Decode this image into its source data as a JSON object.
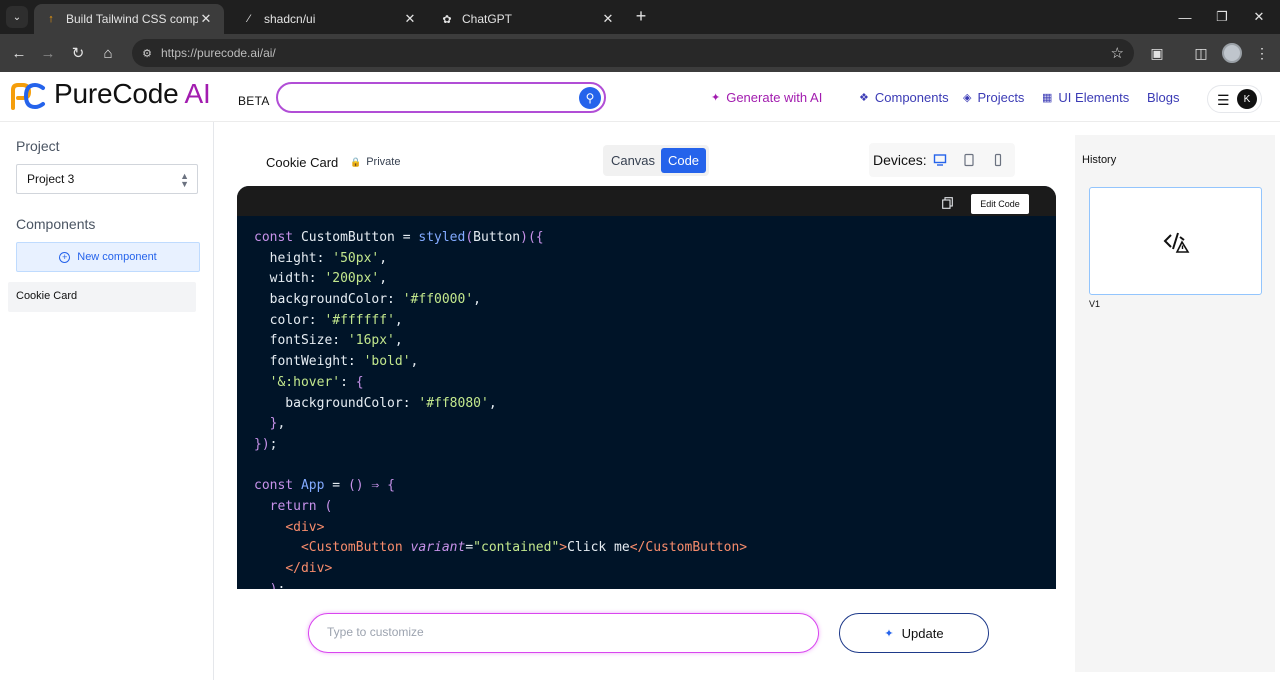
{
  "browser": {
    "tabs": [
      {
        "title": "Build Tailwind CSS components",
        "active": true,
        "icon": "purecode-favicon-icon"
      },
      {
        "title": "shadcn/ui",
        "active": false,
        "icon": "shadcn-favicon-icon"
      },
      {
        "title": "ChatGPT",
        "active": false,
        "icon": "chatgpt-favicon-icon"
      }
    ],
    "url": "https://purecode.ai/ai/"
  },
  "header": {
    "logo_main": "PureCode",
    "logo_ai": "AI",
    "beta": "BETA",
    "search_placeholder": "",
    "nav": {
      "generate": "Generate with AI",
      "components": "Components",
      "projects": "Projects",
      "ui_elements": "UI Elements",
      "blogs": "Blogs"
    },
    "avatar_initial": "K"
  },
  "sidebar": {
    "project_heading": "Project",
    "project_selected": "Project 3",
    "components_heading": "Components",
    "new_component": "New component",
    "items": [
      "Cookie Card"
    ]
  },
  "main": {
    "component_title": "Cookie Card",
    "visibility": "Private",
    "view_tabs": {
      "canvas": "Canvas",
      "code": "Code",
      "active": "Code"
    },
    "devices_label": "Devices:",
    "edit_code": "Edit Code",
    "code_lines": [
      [
        [
          "k",
          "const "
        ],
        [
          "p",
          "CustomButton "
        ],
        [
          "p",
          "= "
        ],
        [
          "fn",
          "styled"
        ],
        [
          "br",
          "("
        ],
        [
          "p",
          "Button"
        ],
        [
          "br",
          ")("
        ],
        [
          "br",
          "{"
        ]
      ],
      [
        [
          "p",
          "  height: "
        ],
        [
          "s",
          "'50px'"
        ],
        [
          "p",
          ","
        ]
      ],
      [
        [
          "p",
          "  width: "
        ],
        [
          "s",
          "'200px'"
        ],
        [
          "p",
          ","
        ]
      ],
      [
        [
          "p",
          "  backgroundColor: "
        ],
        [
          "s",
          "'#ff0000'"
        ],
        [
          "p",
          ","
        ]
      ],
      [
        [
          "p",
          "  color: "
        ],
        [
          "s",
          "'#ffffff'"
        ],
        [
          "p",
          ","
        ]
      ],
      [
        [
          "p",
          "  fontSize: "
        ],
        [
          "s",
          "'16px'"
        ],
        [
          "p",
          ","
        ]
      ],
      [
        [
          "p",
          "  fontWeight: "
        ],
        [
          "s",
          "'bold'"
        ],
        [
          "p",
          ","
        ]
      ],
      [
        [
          "s",
          "  '&:hover'"
        ],
        [
          "p",
          ": "
        ],
        [
          "br",
          "{"
        ]
      ],
      [
        [
          "p",
          "    backgroundColor: "
        ],
        [
          "s",
          "'#ff8080'"
        ],
        [
          "p",
          ","
        ]
      ],
      [
        [
          "br",
          "  }"
        ],
        [
          "p",
          ","
        ]
      ],
      [
        [
          "br",
          "}"
        ],
        [
          "br",
          ")"
        ],
        [
          "p",
          ";"
        ]
      ],
      [],
      [
        [
          "k",
          "const "
        ],
        [
          "fn",
          "App "
        ],
        [
          "p",
          "= "
        ],
        [
          "br",
          "() "
        ],
        [
          "k",
          "⇒ "
        ],
        [
          "br",
          "{"
        ]
      ],
      [
        [
          "k",
          "  return "
        ],
        [
          "br",
          "("
        ]
      ],
      [
        [
          "p",
          "    "
        ],
        [
          "tg",
          "<div>"
        ]
      ],
      [
        [
          "p",
          "      "
        ],
        [
          "tg",
          "<CustomButton "
        ],
        [
          "at",
          "variant"
        ],
        [
          "p",
          "="
        ],
        [
          "s",
          "\"contained\""
        ],
        [
          "tg",
          ">"
        ],
        [
          "p",
          "Click me"
        ],
        [
          "tg",
          "</CustomButton>"
        ]
      ],
      [
        [
          "p",
          "    "
        ],
        [
          "tg",
          "</div>"
        ]
      ],
      [
        [
          "p",
          "  "
        ],
        [
          "br",
          ")"
        ],
        [
          "p",
          ";"
        ]
      ]
    ],
    "prompt_placeholder": "Type to customize",
    "update_label": "Update"
  },
  "history": {
    "title": "History",
    "versions": [
      "V1"
    ]
  },
  "colors": {
    "accent_blue": "#2563eb",
    "brand_purple": "#a21caf",
    "code_bg": "#001428"
  }
}
